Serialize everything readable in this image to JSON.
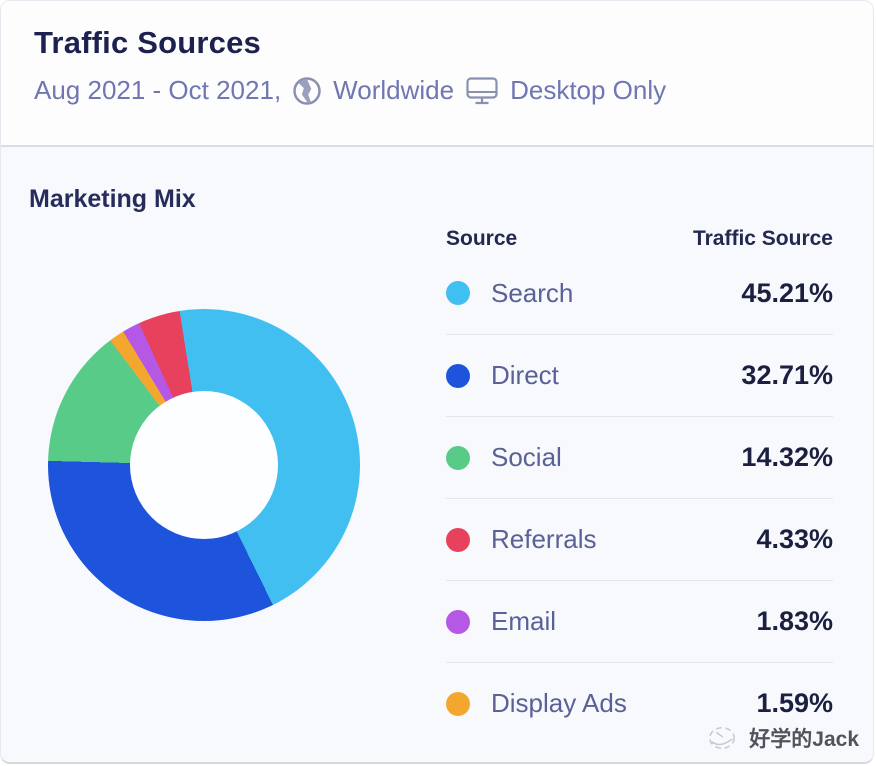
{
  "header": {
    "title": "Traffic Sources",
    "date_range": "Aug 2021 - Oct 2021,",
    "region": "Worldwide",
    "device": "Desktop Only"
  },
  "section": {
    "title": "Marketing Mix"
  },
  "table": {
    "col_source": "Source",
    "col_value": "Traffic Source",
    "rows": [
      {
        "label": "Search",
        "value": "45.21%"
      },
      {
        "label": "Direct",
        "value": "32.71%"
      },
      {
        "label": "Social",
        "value": "14.32%"
      },
      {
        "label": "Referrals",
        "value": "4.33%"
      },
      {
        "label": "Email",
        "value": "1.83%"
      },
      {
        "label": "Display Ads",
        "value": "1.59%"
      }
    ]
  },
  "chart_data": {
    "type": "pie",
    "donut": true,
    "title": "Marketing Mix",
    "unit": "%",
    "start_angle_deg": -9,
    "direction": "clockwise",
    "legend_position": "right-table",
    "segments": [
      {
        "label": "Search",
        "value": 45.21,
        "color": "#41BFF0"
      },
      {
        "label": "Direct",
        "value": 32.71,
        "color": "#1D54DB"
      },
      {
        "label": "Social",
        "value": 14.32,
        "color": "#58CB89"
      },
      {
        "label": "Referrals",
        "value": 4.33,
        "color": "#E7415E"
      },
      {
        "label": "Email",
        "value": 1.83,
        "color": "#B558E5"
      },
      {
        "label": "Display Ads",
        "value": 1.59,
        "color": "#F4A72F"
      }
    ],
    "clockwise_order": [
      0,
      1,
      2,
      5,
      4,
      3
    ]
  },
  "icons": {
    "globe": "globe-icon",
    "desktop": "desktop-monitor-icon",
    "watermark": "sketch-globe-icon"
  },
  "watermark": {
    "text": "好学的Jack"
  },
  "colors": {
    "title_navy": "#1C2150",
    "subtitle_indigo": "#6F76B2",
    "label_indigo": "#5A6198",
    "value_navy": "#1B2040",
    "divider": "#D9DDE3",
    "bg_header": "#FDFDFE",
    "bg_main": "#F7F9FC"
  }
}
